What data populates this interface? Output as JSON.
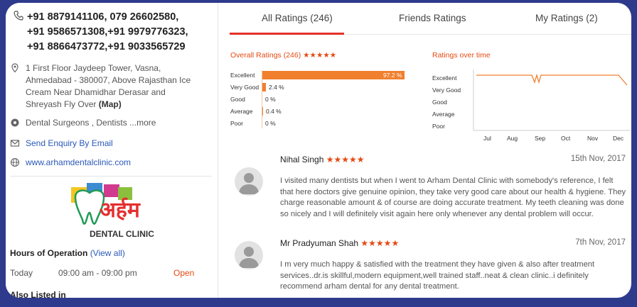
{
  "business": {
    "phones_line1": "+91 8879141106, 079 26602580,",
    "phones_line2": "+91 9586571308,+91 9979776323,",
    "phones_line3": "+91 8866473772,+91 9033565729",
    "address_line1": "1 First Floor Jaydeep Tower, Vasna,",
    "address_line2": "Ahmedabad - 380007, Above Rajasthan Ice",
    "address_line3": "Cream Near Dhamidhar Derasar and",
    "address_line4": "Shreyash Fly Over",
    "map_label": "(Map)",
    "categories": "Dental Surgeons , Dentists",
    "more_label": "...more",
    "enquiry_label": "Send Enquiry By Email",
    "website": "www.arhamdentalclinic.com",
    "logo_hindi": "अर्हम",
    "logo_text": "DENTAL CLINIC",
    "hours_title": "Hours of Operation",
    "view_all": "(View all)",
    "hours_day": "Today",
    "hours_time": "09:00 am - 09:00 pm",
    "hours_status": "Open",
    "also_listed": "Also Listed in"
  },
  "tabs": [
    {
      "label": "All Ratings (246)"
    },
    {
      "label": "Friends Ratings"
    },
    {
      "label": "My Ratings (2)"
    }
  ],
  "ratings": {
    "overall_title": "Overall Ratings (246)",
    "stars": "★★★★★",
    "over_time_title": "Ratings over time",
    "levels": [
      "Excellent",
      "Very Good",
      "Good",
      "Average",
      "Poor"
    ],
    "months": [
      "Jul",
      "Aug",
      "Sep",
      "Oct",
      "Nov",
      "Dec"
    ]
  },
  "chart_data": {
    "type": "bar",
    "categories": [
      "Excellent",
      "Very Good",
      "Good",
      "Average",
      "Poor"
    ],
    "values": [
      97.2,
      2.4,
      0,
      0.4,
      0
    ],
    "value_labels": [
      "97.2 %",
      "2.4 %",
      "0 %",
      "0.4 %",
      "0 %"
    ],
    "title": "Overall Ratings (246)",
    "xlim": [
      0,
      100
    ],
    "color": "#f07f2e"
  },
  "reviews": [
    {
      "name": "Nihal Singh",
      "stars": "★★★★★",
      "date": "15th Nov, 2017",
      "line1": "I visited many dentists but when I went to Arham Dental Clinic with somebody's reference, I felt",
      "line2": "that here doctors give genuine opinion, they take very good care about our health & hygiene. They",
      "line3": "charge reasonable amount & of course are doing accurate treatment. My teeth cleaning was done",
      "line4": "so nicely and I will definitely visit again here only whenever any dental problem will occur."
    },
    {
      "name": "Mr Pradyuman Shah",
      "stars": "★★★★★",
      "date": "7th Nov, 2017",
      "line1": "I m very much happy & satisfied with the treatment they have given & also after treatment",
      "line2": "services..dr.is skillful,modern equipment,well trained staff..neat & clean clinic..i definitely",
      "line3": "recommend arham dental for any dental treatment."
    }
  ],
  "colors": {
    "accent": "#e44a12",
    "bar": "#f07f2e",
    "link": "#2a59b8",
    "frame": "#2e3a8c"
  }
}
